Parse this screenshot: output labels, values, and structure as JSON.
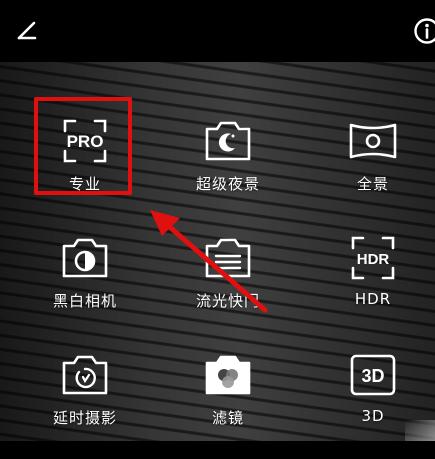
{
  "toolbar": {
    "edit_icon": "edit-pencil-icon",
    "info_icon": "info-icon"
  },
  "modes": [
    {
      "label": "专业",
      "icon": "pro-icon"
    },
    {
      "label": "超级夜景",
      "icon": "night-moon-icon"
    },
    {
      "label": "全景",
      "icon": "panorama-icon"
    },
    {
      "label": "黑白相机",
      "icon": "monochrome-camera-icon"
    },
    {
      "label": "流光快门",
      "icon": "light-painting-icon"
    },
    {
      "label": "HDR",
      "icon": "hdr-icon"
    },
    {
      "label": "延时摄影",
      "icon": "time-lapse-icon"
    },
    {
      "label": "滤镜",
      "icon": "filter-icon"
    },
    {
      "label": "3D",
      "icon": "3d-icon"
    }
  ],
  "icon_text": {
    "pro": "PRO",
    "hdr": "HDR",
    "three_d": "3D"
  },
  "annotation": {
    "highlight_color": "#e11010",
    "arrow_color": "#e11010"
  }
}
